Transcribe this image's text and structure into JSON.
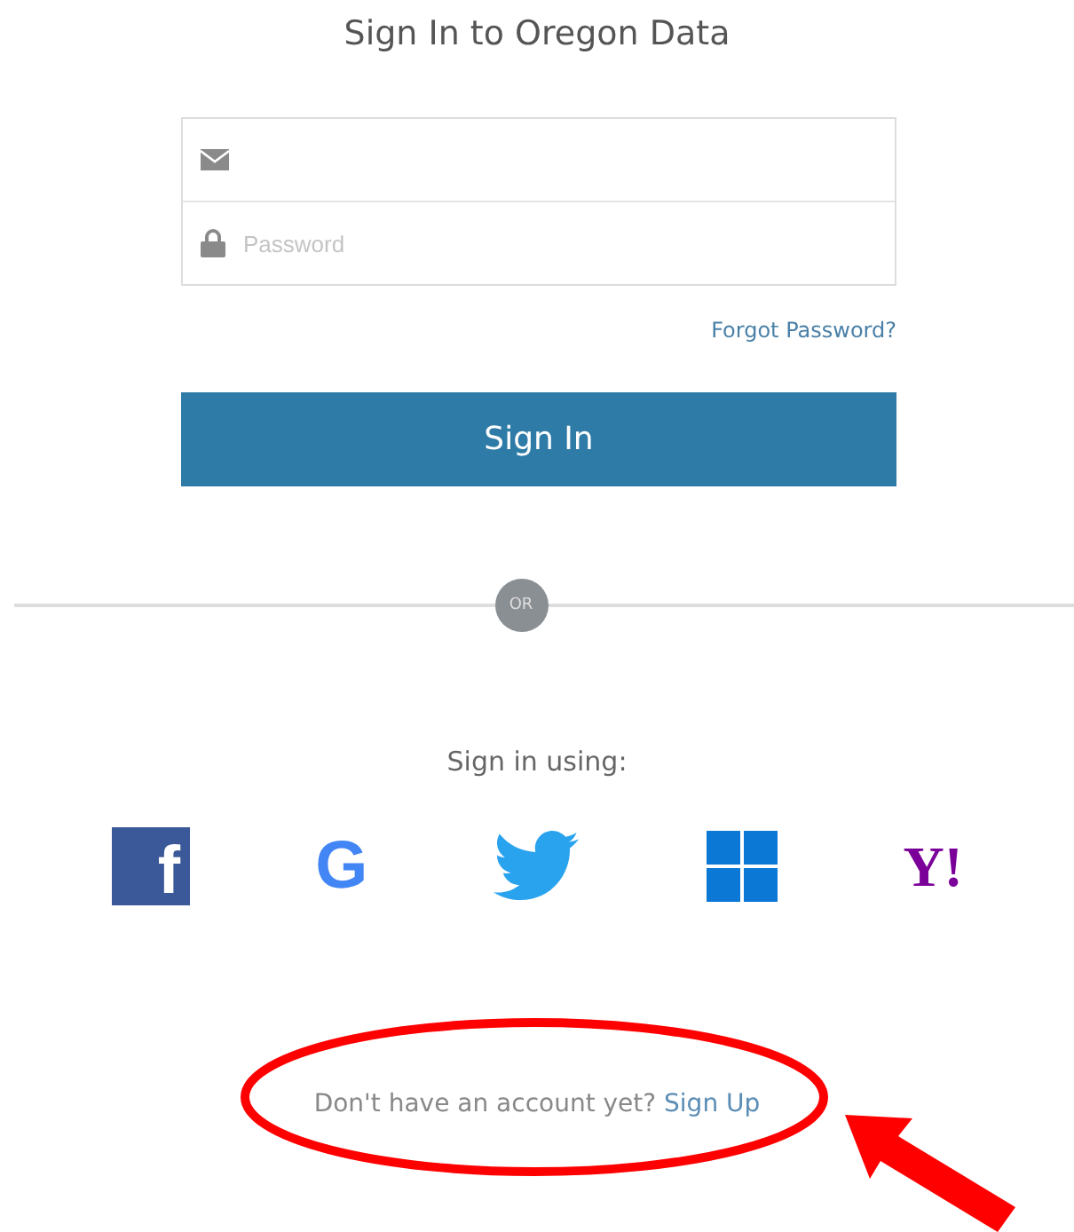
{
  "title": "Sign In to Oregon Data",
  "email_field": {
    "kind": "email"
  },
  "password_field": {
    "placeholder": "Password"
  },
  "forgot_link": "Forgot Password?",
  "sign_in_button": "Sign In",
  "divider_label": "OR",
  "social_heading": "Sign in using:",
  "providers": [
    {
      "kind": "facebook",
      "label": "f"
    },
    {
      "kind": "google",
      "label": "G"
    },
    {
      "kind": "twitter"
    },
    {
      "kind": "windows"
    },
    {
      "kind": "yahoo",
      "label": "Y!"
    }
  ],
  "signup_prompt": "Don't have an account yet?",
  "signup_link": "Sign Up"
}
